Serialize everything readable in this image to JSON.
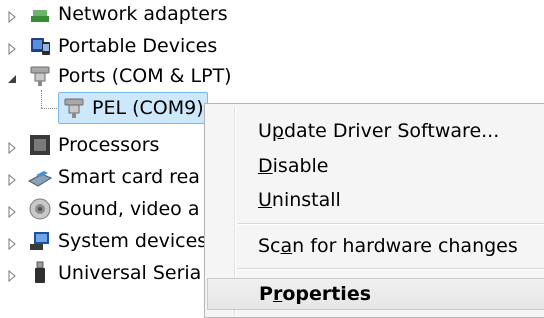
{
  "tree": {
    "items": [
      {
        "label": "Network adapters",
        "icon": "network-adapter-icon"
      },
      {
        "label": "Portable Devices",
        "icon": "portable-device-icon"
      },
      {
        "label": "Ports (COM & LPT)",
        "icon": "port-icon"
      },
      {
        "label": "PEL (COM9)",
        "icon": "port-icon"
      },
      {
        "label": "Processors",
        "icon": "processor-icon"
      },
      {
        "label": "Smart card rea",
        "icon": "smart-card-reader-icon"
      },
      {
        "label": "Sound, video a",
        "icon": "speaker-icon"
      },
      {
        "label": "System devices",
        "icon": "system-device-icon"
      },
      {
        "label": "Universal Seria",
        "icon": "usb-icon"
      }
    ]
  },
  "context_menu": {
    "items": [
      {
        "pre": "U",
        "accel": "p",
        "post": "date Driver Software..."
      },
      {
        "pre": "",
        "accel": "D",
        "post": "isable"
      },
      {
        "pre": "",
        "accel": "U",
        "post": "ninstall"
      },
      {
        "pre": "Sc",
        "accel": "a",
        "post": "n for hardware changes"
      },
      {
        "pre": "P",
        "accel": "r",
        "post": "operties"
      }
    ]
  }
}
